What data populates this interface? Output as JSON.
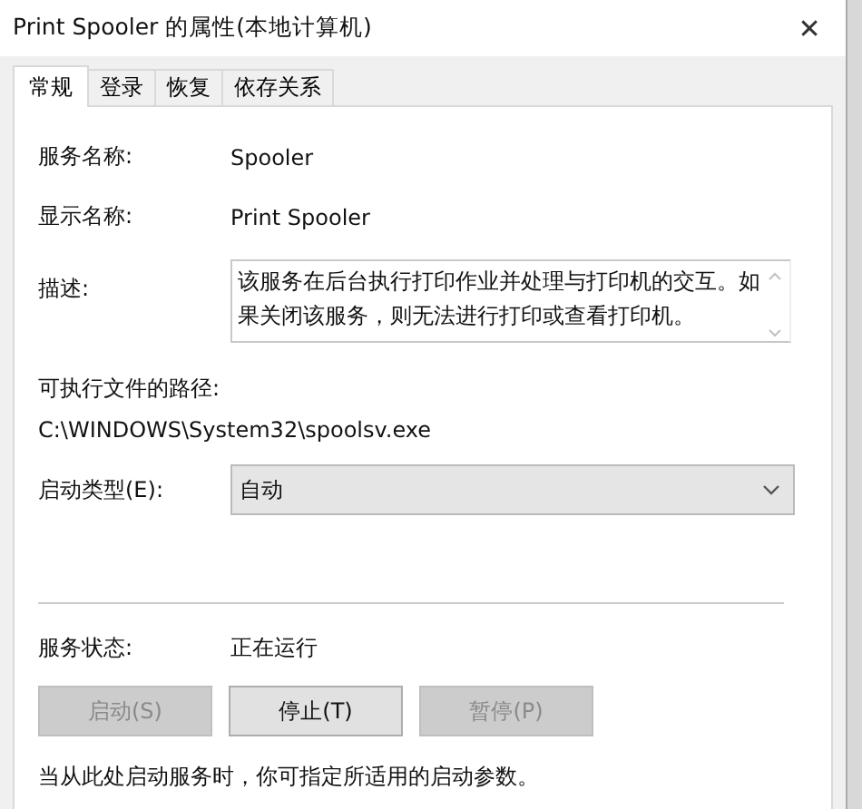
{
  "window": {
    "title": "Print Spooler 的属性(本地计算机)",
    "close": "✕"
  },
  "tabs": [
    {
      "label": "常规",
      "selected": true
    },
    {
      "label": "登录",
      "selected": false
    },
    {
      "label": "恢复",
      "selected": false
    },
    {
      "label": "依存关系",
      "selected": false
    }
  ],
  "service_name": {
    "label": "服务名称:",
    "value": "Spooler"
  },
  "display_name": {
    "label": "显示名称:",
    "value": "Print Spooler"
  },
  "description": {
    "label": "描述:",
    "value": "该服务在后台执行打印作业并处理与打印机的交互。如果关闭该服务，则无法进行打印或查看打印机。"
  },
  "executable_path": {
    "label": "可执行文件的路径:",
    "value": "C:\\WINDOWS\\System32\\spoolsv.exe"
  },
  "startup_type": {
    "label": "启动类型(E):",
    "value": "自动"
  },
  "service_status": {
    "label": "服务状态:",
    "value": "正在运行"
  },
  "buttons": [
    {
      "label": "启动(S)",
      "disabled": true
    },
    {
      "label": "停止(T)",
      "disabled": false
    },
    {
      "label": "暂停(P)",
      "disabled": true
    }
  ],
  "hint": "当从此处启动服务时，你可指定所适用的启动参数。"
}
